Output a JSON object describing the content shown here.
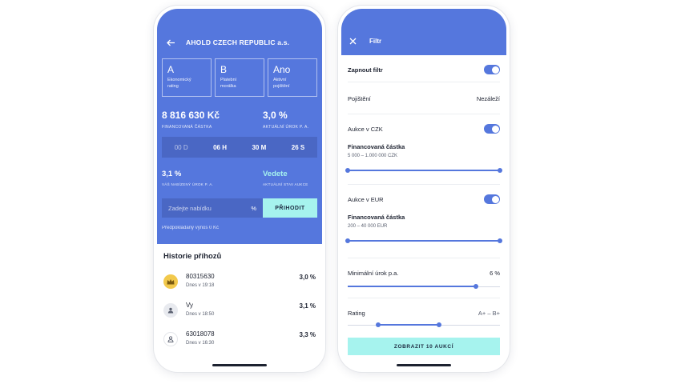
{
  "colors": {
    "primary": "#5577dd",
    "accent": "#a6f3ee",
    "dark_blue": "#4a67c4",
    "gold": "#f2c94c"
  },
  "left": {
    "header": {
      "back_icon": "arrow-left-icon",
      "title": "AHOLD CZECH REPUBLIC a.s."
    },
    "ratings": [
      {
        "value": "A",
        "label": "Ekonomický\nrating"
      },
      {
        "value": "B",
        "label": "Platební\nmorálka"
      },
      {
        "value": "Ano",
        "label": "Aktivní\npojištění"
      }
    ],
    "financed_amount": {
      "value": "8 816 630 Kč",
      "caption": "FINANCOVANÁ ČÁSTKA"
    },
    "current_rate": {
      "value": "3,0 %",
      "caption": "AKTUÁLNÍ ÚROK P. A."
    },
    "timer": {
      "days": "00 D",
      "hours": "06 H",
      "minutes": "30 M",
      "seconds": "26 S"
    },
    "your_rate": {
      "value": "3,1 %",
      "caption": "VÁŠ NABÍZENÝ ÚROK P. A."
    },
    "auction_state": {
      "value": "Vedete",
      "caption": "AKTUÁLNÍ STAV AUKCE"
    },
    "bid": {
      "placeholder": "Zadejte nabídku",
      "unit": "%",
      "button": "PŘIHODIT"
    },
    "expected_yield": "Předpokládaný výnos 0 Kč",
    "history": {
      "title": "Historie příhozů",
      "items": [
        {
          "name": "80315630",
          "time": "Dnes v 19:18",
          "value": "3,0 %",
          "icon": "crown-icon"
        },
        {
          "name": "Vy",
          "time": "Dnes v 18:50",
          "value": "3,1 %",
          "icon": "user-icon"
        },
        {
          "name": "63018078",
          "time": "Dnes v 16:30",
          "value": "3,3 %",
          "icon": "user-icon"
        }
      ]
    }
  },
  "right": {
    "header": {
      "close_icon": "close-icon",
      "title": "Filtr"
    },
    "enable_filter": {
      "label": "Zapnout filtr",
      "on": true
    },
    "insurance": {
      "label": "Pojištění",
      "value": "Nezáleží"
    },
    "auction_czk": {
      "label": "Aukce v CZK",
      "on": true,
      "sub_label": "Financovaná částka",
      "range": "5 000 – 1.000 000 CZK",
      "slider": {
        "min": 0,
        "max": 1
      }
    },
    "auction_eur": {
      "label": "Aukce v EUR",
      "on": true,
      "sub_label": "Financovaná částka",
      "range": "200 – 40 000 EUR",
      "slider": {
        "min": 0,
        "max": 1
      }
    },
    "min_rate": {
      "label": "Minimální úrok p.a.",
      "value": "6 %",
      "slider": {
        "value": 0.84
      }
    },
    "rating": {
      "label": "Rating",
      "value": "A+ – B+",
      "slider": {
        "min": 0.2,
        "max": 0.6
      }
    },
    "show_button": "ZOBRAZIT 10 AUKCÍ"
  }
}
